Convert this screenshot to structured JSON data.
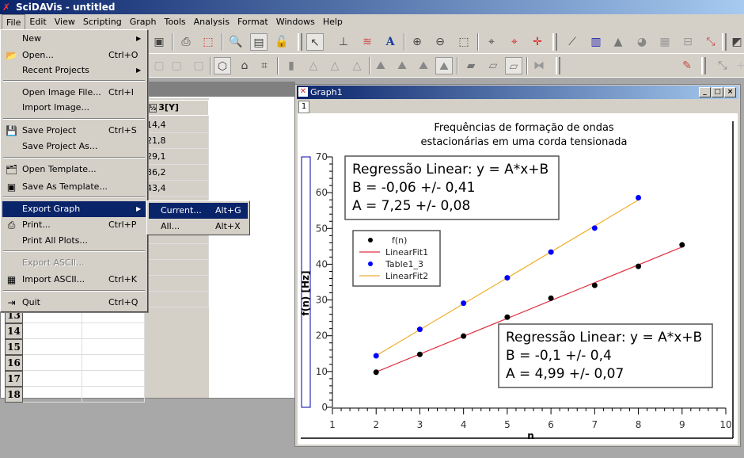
{
  "app": {
    "title": "SciDAVis - untitled"
  },
  "menubar": [
    "File",
    "Edit",
    "View",
    "Scripting",
    "Graph",
    "Tools",
    "Analysis",
    "Format",
    "Windows",
    "Help"
  ],
  "file_menu": {
    "items": [
      {
        "label": "New",
        "shortcut": "",
        "submenu": true,
        "icon": ""
      },
      {
        "label": "Open...",
        "shortcut": "Ctrl+O",
        "icon": "folder-open-icon"
      },
      {
        "label": "Recent Projects",
        "shortcut": "",
        "submenu": true,
        "icon": ""
      },
      {
        "label": "Open Image File...",
        "shortcut": "Ctrl+I",
        "icon": ""
      },
      {
        "label": "Import Image...",
        "shortcut": "",
        "icon": ""
      },
      {
        "label": "Save Project",
        "shortcut": "Ctrl+S",
        "icon": "save-icon"
      },
      {
        "label": "Save Project As...",
        "shortcut": "",
        "icon": ""
      },
      {
        "label": "Open Template...",
        "shortcut": "",
        "icon": "open-template-icon"
      },
      {
        "label": "Save As Template...",
        "shortcut": "",
        "icon": "save-template-icon"
      },
      {
        "label": "Export Graph",
        "shortcut": "",
        "submenu": true,
        "highlighted": true
      },
      {
        "label": "Print...",
        "shortcut": "Ctrl+P",
        "icon": "printer-icon"
      },
      {
        "label": "Print All Plots...",
        "shortcut": ""
      },
      {
        "label": "Export ASCII...",
        "shortcut": "",
        "disabled": true
      },
      {
        "label": "Import ASCII...",
        "shortcut": "Ctrl+K",
        "icon": "import-ascii-icon"
      },
      {
        "label": "Quit",
        "shortcut": "Ctrl+Q",
        "icon": "quit-icon"
      }
    ],
    "export_submenu": [
      {
        "label": "Current...",
        "shortcut": "Alt+G",
        "highlighted": true
      },
      {
        "label": "All...",
        "shortcut": "Alt+X"
      }
    ]
  },
  "table": {
    "column3_header": "3[Y]",
    "column3_values": [
      "14,4",
      "21,8",
      "29,1",
      "36,2",
      "43,4"
    ],
    "row_numbers": [
      "13",
      "14",
      "15",
      "16",
      "17",
      "18"
    ]
  },
  "graph_window": {
    "title": "Graph1",
    "layer_tab": "1"
  },
  "chart_data": {
    "type": "scatter",
    "title": "Frequências de formação de ondas\nestacionárias em uma corda tensionada",
    "title_lines": [
      "Frequências de formação de ondas",
      "estacionárias em uma corda tensionada"
    ],
    "xlabel": "n",
    "ylabel": "f(n) [Hz]",
    "xlim": [
      1,
      10
    ],
    "ylim": [
      0,
      70
    ],
    "xticks": [
      "1",
      "2",
      "3",
      "4",
      "5",
      "6",
      "7",
      "8",
      "9",
      "10"
    ],
    "yticks": [
      "0",
      "10",
      "20",
      "30",
      "40",
      "50",
      "60",
      "70"
    ],
    "grid": false,
    "legend_position": "upper-left",
    "series": [
      {
        "name": "f(n)",
        "kind": "points",
        "color": "#000000",
        "x": [
          2,
          3,
          4,
          5,
          6,
          7,
          8,
          9
        ],
        "y": [
          9.8,
          14.8,
          19.9,
          25.2,
          30.5,
          34.1,
          39.4,
          45.4
        ]
      },
      {
        "name": "LinearFit1",
        "kind": "line",
        "color": "#e03040",
        "slope": 4.99,
        "intercept": -0.1,
        "x": [
          2,
          9
        ]
      },
      {
        "name": "Table1_3",
        "kind": "points",
        "color": "#0000ff",
        "x": [
          2,
          3,
          4,
          5,
          6,
          7,
          8
        ],
        "y": [
          14.4,
          21.8,
          29.1,
          36.2,
          43.4,
          50.1,
          58.6
        ]
      },
      {
        "name": "LinearFit2",
        "kind": "line",
        "color": "#f0b030",
        "slope": 7.25,
        "intercept": -0.06,
        "x": [
          2,
          8
        ]
      }
    ],
    "annotations": [
      {
        "lines": [
          "Regressão Linear: y = A*x+B",
          "B  = -0,06 +/- 0,41",
          "A = 7,25 +/- 0,08"
        ]
      },
      {
        "lines": [
          "Regressão Linear: y = A*x+B",
          "B  = -0,1 +/- 0,4",
          "A = 4,99 +/- 0,07"
        ]
      }
    ]
  }
}
